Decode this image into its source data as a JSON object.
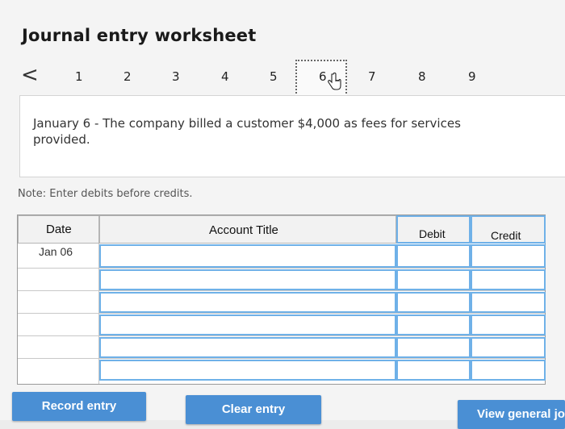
{
  "title": "Journal entry worksheet",
  "pager": {
    "prev_symbol": "<",
    "pages": [
      "1",
      "2",
      "3",
      "4",
      "5",
      "6",
      "7",
      "8",
      "9"
    ],
    "active_page": "6"
  },
  "transaction": {
    "description": "January 6 - The company billed a customer $4,000 as fees for services provided."
  },
  "note": "Note: Enter debits before credits.",
  "table": {
    "headers": {
      "date": "Date",
      "account": "Account Title",
      "debit": "Debit",
      "credit": "Credit"
    },
    "rows": [
      {
        "date": "Jan 06",
        "account": "",
        "debit": "",
        "credit": ""
      },
      {
        "date": "",
        "account": "",
        "debit": "",
        "credit": ""
      },
      {
        "date": "",
        "account": "",
        "debit": "",
        "credit": ""
      },
      {
        "date": "",
        "account": "",
        "debit": "",
        "credit": ""
      },
      {
        "date": "",
        "account": "",
        "debit": "",
        "credit": ""
      },
      {
        "date": "",
        "account": "",
        "debit": "",
        "credit": ""
      }
    ]
  },
  "buttons": {
    "record": "Record entry",
    "clear": "Clear entry",
    "view": "View general jo"
  },
  "colors": {
    "button_bg": "#4a8fd4",
    "input_border": "#6fb1e8"
  },
  "icons": {
    "cursor": "hand-pointer-icon",
    "prev": "chevron-left-icon"
  }
}
